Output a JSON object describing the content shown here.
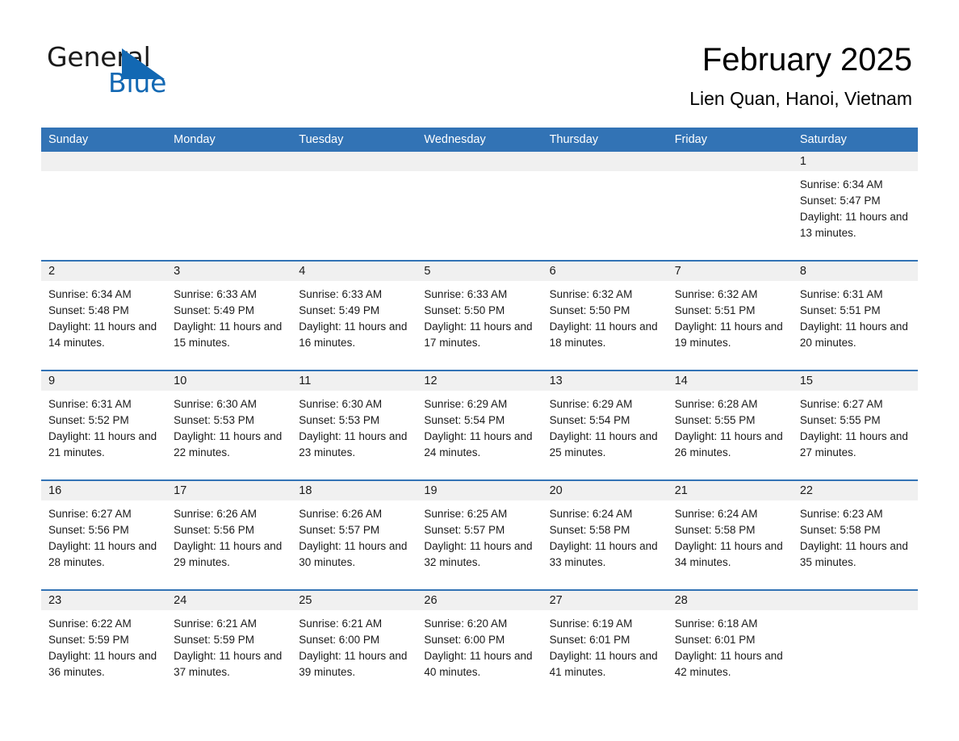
{
  "brand": {
    "name_part1": "General",
    "name_part2": "Blue",
    "triangle_icon": "blue-triangle-icon",
    "accent_color": "#1268b3"
  },
  "header": {
    "title": "February 2025",
    "subtitle": "Lien Quan, Hanoi, Vietnam"
  },
  "calendar": {
    "header_color": "#3273b5",
    "daynum_band_color": "#f0f0f0",
    "weekdays": [
      "Sunday",
      "Monday",
      "Tuesday",
      "Wednesday",
      "Thursday",
      "Friday",
      "Saturday"
    ],
    "labels": {
      "sunrise": "Sunrise:",
      "sunset": "Sunset:",
      "daylight": "Daylight:"
    },
    "weeks": [
      [
        {
          "day": ""
        },
        {
          "day": ""
        },
        {
          "day": ""
        },
        {
          "day": ""
        },
        {
          "day": ""
        },
        {
          "day": ""
        },
        {
          "day": "1",
          "sunrise": "Sunrise: 6:34 AM",
          "sunset": "Sunset: 5:47 PM",
          "daylight": "Daylight: 11 hours and 13 minutes."
        }
      ],
      [
        {
          "day": "2",
          "sunrise": "Sunrise: 6:34 AM",
          "sunset": "Sunset: 5:48 PM",
          "daylight": "Daylight: 11 hours and 14 minutes."
        },
        {
          "day": "3",
          "sunrise": "Sunrise: 6:33 AM",
          "sunset": "Sunset: 5:49 PM",
          "daylight": "Daylight: 11 hours and 15 minutes."
        },
        {
          "day": "4",
          "sunrise": "Sunrise: 6:33 AM",
          "sunset": "Sunset: 5:49 PM",
          "daylight": "Daylight: 11 hours and 16 minutes."
        },
        {
          "day": "5",
          "sunrise": "Sunrise: 6:33 AM",
          "sunset": "Sunset: 5:50 PM",
          "daylight": "Daylight: 11 hours and 17 minutes."
        },
        {
          "day": "6",
          "sunrise": "Sunrise: 6:32 AM",
          "sunset": "Sunset: 5:50 PM",
          "daylight": "Daylight: 11 hours and 18 minutes."
        },
        {
          "day": "7",
          "sunrise": "Sunrise: 6:32 AM",
          "sunset": "Sunset: 5:51 PM",
          "daylight": "Daylight: 11 hours and 19 minutes."
        },
        {
          "day": "8",
          "sunrise": "Sunrise: 6:31 AM",
          "sunset": "Sunset: 5:51 PM",
          "daylight": "Daylight: 11 hours and 20 minutes."
        }
      ],
      [
        {
          "day": "9",
          "sunrise": "Sunrise: 6:31 AM",
          "sunset": "Sunset: 5:52 PM",
          "daylight": "Daylight: 11 hours and 21 minutes."
        },
        {
          "day": "10",
          "sunrise": "Sunrise: 6:30 AM",
          "sunset": "Sunset: 5:53 PM",
          "daylight": "Daylight: 11 hours and 22 minutes."
        },
        {
          "day": "11",
          "sunrise": "Sunrise: 6:30 AM",
          "sunset": "Sunset: 5:53 PM",
          "daylight": "Daylight: 11 hours and 23 minutes."
        },
        {
          "day": "12",
          "sunrise": "Sunrise: 6:29 AM",
          "sunset": "Sunset: 5:54 PM",
          "daylight": "Daylight: 11 hours and 24 minutes."
        },
        {
          "day": "13",
          "sunrise": "Sunrise: 6:29 AM",
          "sunset": "Sunset: 5:54 PM",
          "daylight": "Daylight: 11 hours and 25 minutes."
        },
        {
          "day": "14",
          "sunrise": "Sunrise: 6:28 AM",
          "sunset": "Sunset: 5:55 PM",
          "daylight": "Daylight: 11 hours and 26 minutes."
        },
        {
          "day": "15",
          "sunrise": "Sunrise: 6:27 AM",
          "sunset": "Sunset: 5:55 PM",
          "daylight": "Daylight: 11 hours and 27 minutes."
        }
      ],
      [
        {
          "day": "16",
          "sunrise": "Sunrise: 6:27 AM",
          "sunset": "Sunset: 5:56 PM",
          "daylight": "Daylight: 11 hours and 28 minutes."
        },
        {
          "day": "17",
          "sunrise": "Sunrise: 6:26 AM",
          "sunset": "Sunset: 5:56 PM",
          "daylight": "Daylight: 11 hours and 29 minutes."
        },
        {
          "day": "18",
          "sunrise": "Sunrise: 6:26 AM",
          "sunset": "Sunset: 5:57 PM",
          "daylight": "Daylight: 11 hours and 30 minutes."
        },
        {
          "day": "19",
          "sunrise": "Sunrise: 6:25 AM",
          "sunset": "Sunset: 5:57 PM",
          "daylight": "Daylight: 11 hours and 32 minutes."
        },
        {
          "day": "20",
          "sunrise": "Sunrise: 6:24 AM",
          "sunset": "Sunset: 5:58 PM",
          "daylight": "Daylight: 11 hours and 33 minutes."
        },
        {
          "day": "21",
          "sunrise": "Sunrise: 6:24 AM",
          "sunset": "Sunset: 5:58 PM",
          "daylight": "Daylight: 11 hours and 34 minutes."
        },
        {
          "day": "22",
          "sunrise": "Sunrise: 6:23 AM",
          "sunset": "Sunset: 5:58 PM",
          "daylight": "Daylight: 11 hours and 35 minutes."
        }
      ],
      [
        {
          "day": "23",
          "sunrise": "Sunrise: 6:22 AM",
          "sunset": "Sunset: 5:59 PM",
          "daylight": "Daylight: 11 hours and 36 minutes."
        },
        {
          "day": "24",
          "sunrise": "Sunrise: 6:21 AM",
          "sunset": "Sunset: 5:59 PM",
          "daylight": "Daylight: 11 hours and 37 minutes."
        },
        {
          "day": "25",
          "sunrise": "Sunrise: 6:21 AM",
          "sunset": "Sunset: 6:00 PM",
          "daylight": "Daylight: 11 hours and 39 minutes."
        },
        {
          "day": "26",
          "sunrise": "Sunrise: 6:20 AM",
          "sunset": "Sunset: 6:00 PM",
          "daylight": "Daylight: 11 hours and 40 minutes."
        },
        {
          "day": "27",
          "sunrise": "Sunrise: 6:19 AM",
          "sunset": "Sunset: 6:01 PM",
          "daylight": "Daylight: 11 hours and 41 minutes."
        },
        {
          "day": "28",
          "sunrise": "Sunrise: 6:18 AM",
          "sunset": "Sunset: 6:01 PM",
          "daylight": "Daylight: 11 hours and 42 minutes."
        },
        {
          "day": ""
        }
      ]
    ]
  }
}
